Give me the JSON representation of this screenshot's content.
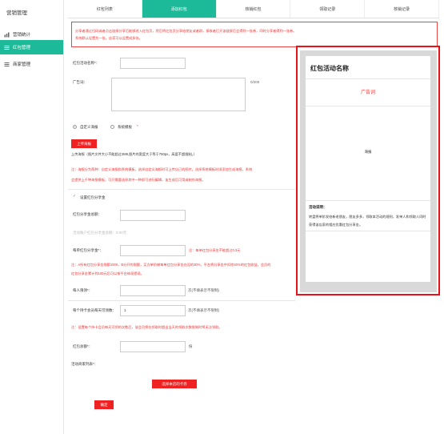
{
  "sidebar": {
    "title": "营销管理",
    "items": [
      {
        "label": "营销统计",
        "icon": "chart-icon"
      },
      {
        "label": "红包管理",
        "icon": "list-icon"
      },
      {
        "label": "商家管理",
        "icon": "list-icon"
      }
    ]
  },
  "tabs": [
    "红包列表",
    "添加红包",
    "核销红包",
    "领取记录",
    "核销记录"
  ],
  "notice": {
    "line1": "分享者通过扫码或者点击链接分享后能够进入红包页，然后将红包页分享给朋友或者群，接收者打开该链接后会得到一张券，同时分享者得到一张券。",
    "line2": "系统默认设置为一张，店家可以设置成多张。"
  },
  "form": {
    "name_label": "红包活动名称*：",
    "ad_label": "广告词：",
    "ad_counter": "0/200",
    "radio_custom": "自定义海报",
    "radio_system": "系统模板",
    "upload_button": "上传海报",
    "upload_hint": "上传海报（图片文件大小不能超过2M8,图片的宽度大于等于750px，高度不超限制。）",
    "notice1": "注：海报分为两种：自定义海报和系统模板，选择自定义海报时可上传自己的图片。选择系统模板时须添加生成海报，系统",
    "notice2": "会提供上千种海报模板，可只需要选择其中一种即可进行编辑，该生成后可用或制作海报。",
    "share_check": "设置红包分享金",
    "share_amount_label": "红包分享金总额：",
    "share_gray": "活动账户红包分享金总额：0.00元",
    "per_amount_label": "每单红包分享金*：",
    "per_amount_note": "注：每单红包分享金不能超过0.3元",
    "hint_a1": "注：A所有红包分享金限额1000，B分开的限额，买方单阶梯每单红包分享金在设的30%，平台将分享金中扣除40%的红包收益，会员的",
    "hint_a2": "红包分享金累计到100元后可以按平台体现提现。",
    "daily_limit_label": "每人限领*：",
    "daily_limit_note": "次(不填表示不限制)",
    "per_day_label": "每个持卡会员每天可领数：",
    "per_day_value": "1",
    "per_day_note": "次(不填表示不限制)",
    "hint_b": "注：设置每个持卡会员每天可领的次数后，该会员将在领取时超出当天的领取次数限制时将无法领取。",
    "total_label": "红包总额*：",
    "total_unit": "份",
    "merchant_label": "活动商家列表*：",
    "select_button": "选择本店的卡券",
    "confirm_button": "确定"
  },
  "preview": {
    "title": "红包活动名称",
    "ad": "广告词",
    "poster": "海报",
    "rules_label": "活动说明：",
    "rules_text": "转盘将单阶发给新老朋友，朋友多多，领取本活动的规则，发单人和领取人同时获得该店家的相应优惠红包分享金。"
  },
  "colors": {
    "accent": "#1dba9a",
    "alert": "#e33333",
    "highlight_border": "#e8121a"
  }
}
